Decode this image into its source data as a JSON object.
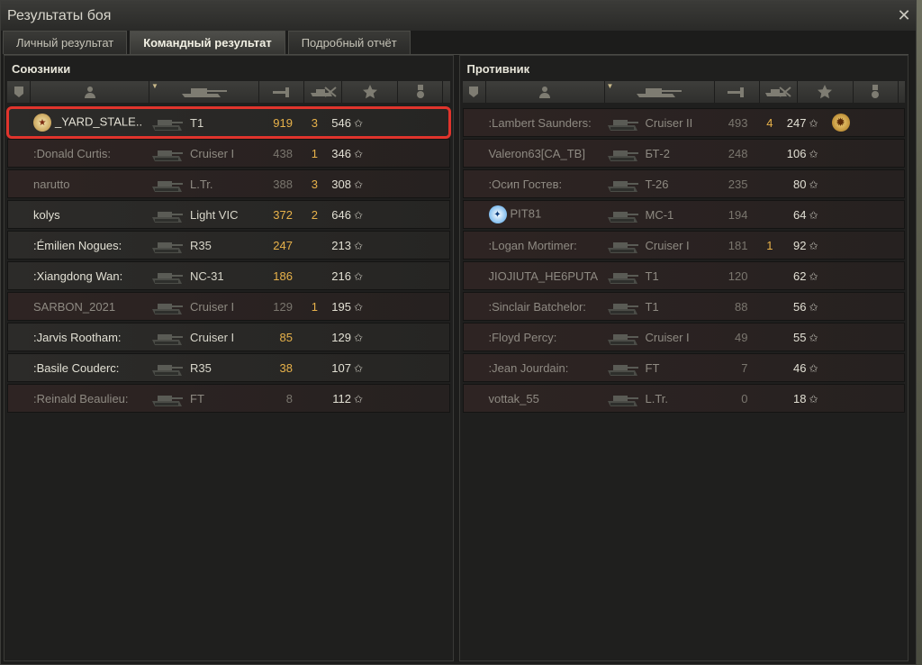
{
  "window": {
    "title": "Результаты боя",
    "close_icon": "close-icon"
  },
  "tabs": [
    {
      "label": "Личный результат",
      "active": false
    },
    {
      "label": "Командный результат",
      "active": true
    },
    {
      "label": "Подробный отчёт",
      "active": false
    }
  ],
  "allies": {
    "title": "Союзники",
    "rows": [
      {
        "name": "_YARD_STALE..",
        "tank": "T1",
        "damage": "919",
        "frags": "3",
        "xp": "546",
        "dead": false,
        "highlight": true,
        "badge": "medal-badge-icon"
      },
      {
        "name": ":Donald Curtis:",
        "tank": "Cruiser I",
        "damage": "438",
        "frags": "1",
        "xp": "346",
        "dead": true
      },
      {
        "name": "narutto",
        "tank": "L.Tr.",
        "damage": "388",
        "frags": "3",
        "xp": "308",
        "dead": true
      },
      {
        "name": "kolys",
        "tank": "Light VIC",
        "damage": "372",
        "frags": "2",
        "xp": "646",
        "dead": false
      },
      {
        "name": ":Émilien Nogues:",
        "tank": "R35",
        "damage": "247",
        "frags": "",
        "xp": "213",
        "dead": false
      },
      {
        "name": ":Xiangdong Wan:",
        "tank": "NC-31",
        "damage": "186",
        "frags": "",
        "xp": "216",
        "dead": false
      },
      {
        "name": "SARBON_2021",
        "tank": "Cruiser I",
        "damage": "129",
        "frags": "1",
        "xp": "195",
        "dead": true
      },
      {
        "name": ":Jarvis Rootham:",
        "tank": "Cruiser I",
        "damage": "85",
        "frags": "",
        "xp": "129",
        "dead": false
      },
      {
        "name": ":Basile Couderc:",
        "tank": "R35",
        "damage": "38",
        "frags": "",
        "xp": "107",
        "dead": false
      },
      {
        "name": ":Reinald Beaulieu:",
        "tank": "FT",
        "damage": "8",
        "frags": "",
        "xp": "112",
        "dead": true
      }
    ]
  },
  "enemies": {
    "title": "Противник",
    "rows": [
      {
        "name": ":Lambert Saunders:",
        "tank": "Cruiser II",
        "damage": "493",
        "frags": "4",
        "xp": "247",
        "dead": true,
        "medal": "order-medal-icon"
      },
      {
        "name": "Valeron63[CA_TB]",
        "tank": "БТ-2",
        "damage": "248",
        "frags": "",
        "xp": "106",
        "dead": true
      },
      {
        "name": ":Осип Гостев:",
        "tank": "T-26",
        "damage": "235",
        "frags": "",
        "xp": "80",
        "dead": true
      },
      {
        "name": "PIT81",
        "tank": "MC-1",
        "damage": "194",
        "frags": "",
        "xp": "64",
        "dead": true,
        "badge": "star-badge-icon"
      },
      {
        "name": ":Logan Mortimer:",
        "tank": "Cruiser I",
        "damage": "181",
        "frags": "1",
        "xp": "92",
        "dead": true
      },
      {
        "name": "JIOJIUTA_HE6PUTA",
        "tank": "T1",
        "damage": "120",
        "frags": "",
        "xp": "62",
        "dead": true
      },
      {
        "name": ":Sinclair Batchelor:",
        "tank": "T1",
        "damage": "88",
        "frags": "",
        "xp": "56",
        "dead": true
      },
      {
        "name": ":Floyd Percy:",
        "tank": "Cruiser I",
        "damage": "49",
        "frags": "",
        "xp": "55",
        "dead": true
      },
      {
        "name": ":Jean Jourdain:",
        "tank": "FT",
        "damage": "7",
        "frags": "",
        "xp": "46",
        "dead": true
      },
      {
        "name": "vottak_55",
        "tank": "L.Tr.",
        "damage": "0",
        "frags": "",
        "xp": "18",
        "dead": true
      }
    ]
  },
  "columns": [
    "squad-icon",
    "player-icon",
    "tank-icon",
    "damage-icon",
    "frags-icon",
    "xp-star-icon",
    "medal-icon"
  ],
  "colors": {
    "highlight": "#e0342c",
    "damage": "#e8b24a",
    "alive_text": "#e2e0d4",
    "dead_text": "#8e8a82"
  }
}
